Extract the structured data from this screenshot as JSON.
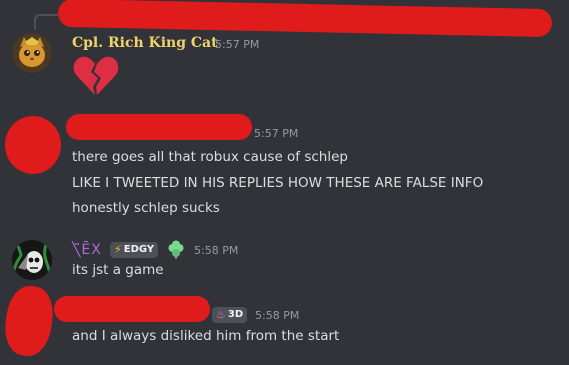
{
  "colors": {
    "background": "#313338",
    "message_text": "#dbdee1",
    "timestamp": "#949ba4",
    "username_gold": "#f0d46a",
    "username_purple": "#b26bd6",
    "redaction": "#e01b1b",
    "heart": "#dd2e44",
    "tag_bg": "#4e5058",
    "clan_green": "#7bd88f"
  },
  "messages": [
    {
      "author": "Cpl. Rich King Cat",
      "timestamp": "5:57 PM",
      "content_icon": "broken-heart-emoji",
      "avatar_icon": "cat-avatar"
    },
    {
      "author": "",
      "timestamp": "5:57 PM",
      "lines": [
        "there goes all that robux cause of schlep",
        "LIKE I TWEETED IN HIS REPLIES HOW THESE ARE FALSE INFO",
        "honestly schlep sucks"
      ]
    },
    {
      "author": "╲̃ĒХ",
      "tag": "EDGY",
      "tag_icon": "lightning-icon",
      "badge_icon": "clover-badge-icon",
      "timestamp": "5:58 PM",
      "lines": [
        "its jst a game"
      ]
    },
    {
      "author": "",
      "tag": "3D",
      "tag_icon": "flame-icon",
      "timestamp": "5:58 PM",
      "lines": [
        "and I always disliked him from the start"
      ]
    }
  ]
}
